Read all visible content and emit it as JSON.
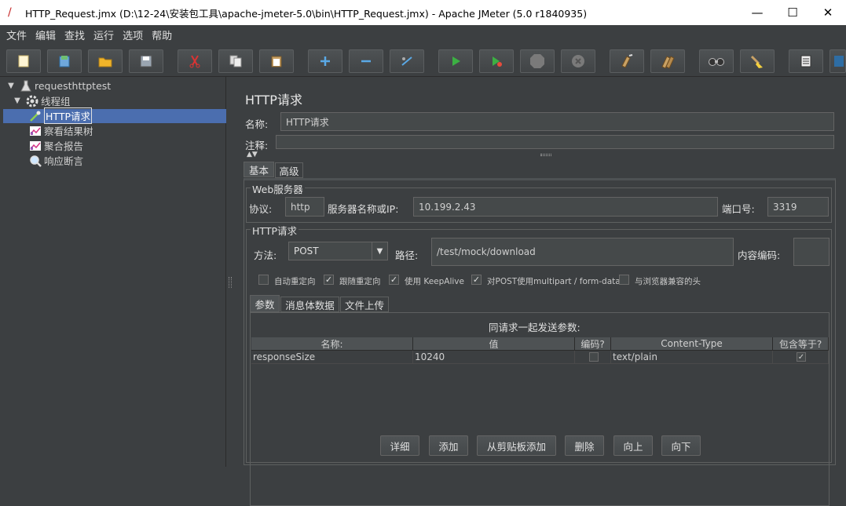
{
  "window": {
    "title": "HTTP_Request.jmx (D:\\12-24\\安装包工具\\apache-jmeter-5.0\\bin\\HTTP_Request.jmx) - Apache JMeter (5.0 r1840935)",
    "minimize": "—",
    "maximize": "☐",
    "close": "✕"
  },
  "menu": [
    "文件",
    "编辑",
    "查找",
    "运行",
    "选项",
    "帮助"
  ],
  "tree": {
    "root": "requesthttptest",
    "thread_group": "线程组",
    "http_request": "HTTP请求",
    "results_tree": "察看结果树",
    "aggregate_report": "聚合报告",
    "response_assertion": "响应断言"
  },
  "panel": {
    "title": "HTTP请求",
    "name_label": "名称:",
    "name_value": "HTTP请求",
    "comment_label": "注释:",
    "comment_value": "",
    "tabs": [
      "基本",
      "高级"
    ],
    "web_server": {
      "legend": "Web服务器",
      "protocol_label": "协议:",
      "protocol_value": "http",
      "server_label": "服务器名称或IP:",
      "server_value": "10.199.2.43",
      "port_label": "端口号:",
      "port_value": "3319"
    },
    "http_request": {
      "legend": "HTTP请求",
      "method_label": "方法:",
      "method_value": "POST",
      "path_label": "路径:",
      "path_value": "/test/mock/download",
      "encoding_label": "内容编码:",
      "encoding_value": ""
    },
    "options": [
      {
        "label": "自动重定向",
        "checked": false
      },
      {
        "label": "跟随重定向",
        "checked": true
      },
      {
        "label": "使用 KeepAlive",
        "checked": true
      },
      {
        "label": "对POST使用multipart / form-data",
        "checked": true
      },
      {
        "label": "与浏览器兼容的头",
        "checked": false
      }
    ],
    "sub_tabs": [
      "参数",
      "消息体数据",
      "文件上传"
    ],
    "params_caption": "同请求一起发送参数:",
    "columns": [
      "名称:",
      "值",
      "编码?",
      "Content-Type",
      "包含等于?"
    ],
    "rows": [
      {
        "name": "responseSize",
        "value": "10240",
        "encode": false,
        "content_type": "text/plain",
        "include_equals": true
      }
    ],
    "buttons": [
      "详细",
      "添加",
      "从剪贴板添加",
      "删除",
      "向上",
      "向下"
    ]
  },
  "colors": {
    "background": "#3c3f41",
    "selection": "#4b6eaf",
    "field": "#45494a"
  }
}
